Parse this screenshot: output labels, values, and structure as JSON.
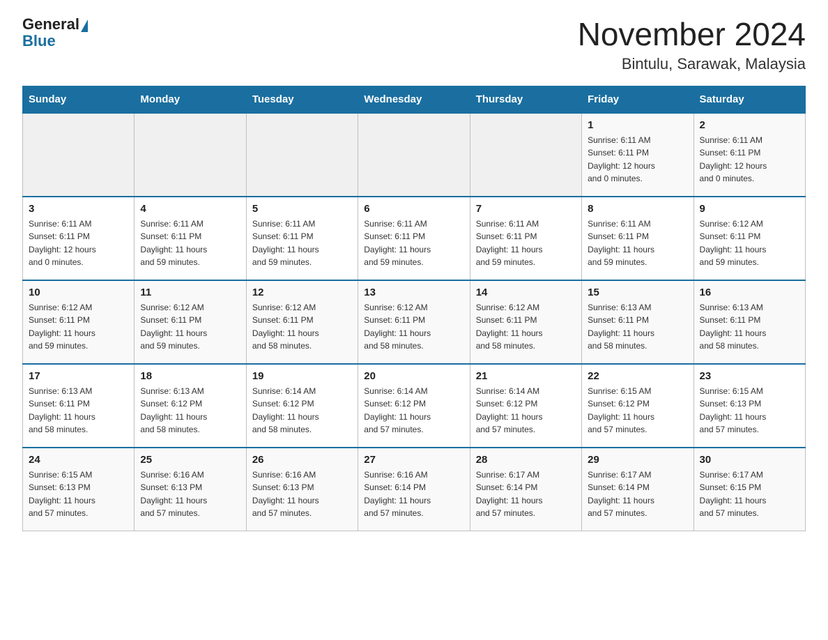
{
  "header": {
    "logo_general": "General",
    "logo_blue": "Blue",
    "month_title": "November 2024",
    "location": "Bintulu, Sarawak, Malaysia"
  },
  "days_of_week": [
    "Sunday",
    "Monday",
    "Tuesday",
    "Wednesday",
    "Thursday",
    "Friday",
    "Saturday"
  ],
  "weeks": [
    [
      {
        "day": "",
        "info": ""
      },
      {
        "day": "",
        "info": ""
      },
      {
        "day": "",
        "info": ""
      },
      {
        "day": "",
        "info": ""
      },
      {
        "day": "",
        "info": ""
      },
      {
        "day": "1",
        "info": "Sunrise: 6:11 AM\nSunset: 6:11 PM\nDaylight: 12 hours\nand 0 minutes."
      },
      {
        "day": "2",
        "info": "Sunrise: 6:11 AM\nSunset: 6:11 PM\nDaylight: 12 hours\nand 0 minutes."
      }
    ],
    [
      {
        "day": "3",
        "info": "Sunrise: 6:11 AM\nSunset: 6:11 PM\nDaylight: 12 hours\nand 0 minutes."
      },
      {
        "day": "4",
        "info": "Sunrise: 6:11 AM\nSunset: 6:11 PM\nDaylight: 11 hours\nand 59 minutes."
      },
      {
        "day": "5",
        "info": "Sunrise: 6:11 AM\nSunset: 6:11 PM\nDaylight: 11 hours\nand 59 minutes."
      },
      {
        "day": "6",
        "info": "Sunrise: 6:11 AM\nSunset: 6:11 PM\nDaylight: 11 hours\nand 59 minutes."
      },
      {
        "day": "7",
        "info": "Sunrise: 6:11 AM\nSunset: 6:11 PM\nDaylight: 11 hours\nand 59 minutes."
      },
      {
        "day": "8",
        "info": "Sunrise: 6:11 AM\nSunset: 6:11 PM\nDaylight: 11 hours\nand 59 minutes."
      },
      {
        "day": "9",
        "info": "Sunrise: 6:12 AM\nSunset: 6:11 PM\nDaylight: 11 hours\nand 59 minutes."
      }
    ],
    [
      {
        "day": "10",
        "info": "Sunrise: 6:12 AM\nSunset: 6:11 PM\nDaylight: 11 hours\nand 59 minutes."
      },
      {
        "day": "11",
        "info": "Sunrise: 6:12 AM\nSunset: 6:11 PM\nDaylight: 11 hours\nand 59 minutes."
      },
      {
        "day": "12",
        "info": "Sunrise: 6:12 AM\nSunset: 6:11 PM\nDaylight: 11 hours\nand 58 minutes."
      },
      {
        "day": "13",
        "info": "Sunrise: 6:12 AM\nSunset: 6:11 PM\nDaylight: 11 hours\nand 58 minutes."
      },
      {
        "day": "14",
        "info": "Sunrise: 6:12 AM\nSunset: 6:11 PM\nDaylight: 11 hours\nand 58 minutes."
      },
      {
        "day": "15",
        "info": "Sunrise: 6:13 AM\nSunset: 6:11 PM\nDaylight: 11 hours\nand 58 minutes."
      },
      {
        "day": "16",
        "info": "Sunrise: 6:13 AM\nSunset: 6:11 PM\nDaylight: 11 hours\nand 58 minutes."
      }
    ],
    [
      {
        "day": "17",
        "info": "Sunrise: 6:13 AM\nSunset: 6:11 PM\nDaylight: 11 hours\nand 58 minutes."
      },
      {
        "day": "18",
        "info": "Sunrise: 6:13 AM\nSunset: 6:12 PM\nDaylight: 11 hours\nand 58 minutes."
      },
      {
        "day": "19",
        "info": "Sunrise: 6:14 AM\nSunset: 6:12 PM\nDaylight: 11 hours\nand 58 minutes."
      },
      {
        "day": "20",
        "info": "Sunrise: 6:14 AM\nSunset: 6:12 PM\nDaylight: 11 hours\nand 57 minutes."
      },
      {
        "day": "21",
        "info": "Sunrise: 6:14 AM\nSunset: 6:12 PM\nDaylight: 11 hours\nand 57 minutes."
      },
      {
        "day": "22",
        "info": "Sunrise: 6:15 AM\nSunset: 6:12 PM\nDaylight: 11 hours\nand 57 minutes."
      },
      {
        "day": "23",
        "info": "Sunrise: 6:15 AM\nSunset: 6:13 PM\nDaylight: 11 hours\nand 57 minutes."
      }
    ],
    [
      {
        "day": "24",
        "info": "Sunrise: 6:15 AM\nSunset: 6:13 PM\nDaylight: 11 hours\nand 57 minutes."
      },
      {
        "day": "25",
        "info": "Sunrise: 6:16 AM\nSunset: 6:13 PM\nDaylight: 11 hours\nand 57 minutes."
      },
      {
        "day": "26",
        "info": "Sunrise: 6:16 AM\nSunset: 6:13 PM\nDaylight: 11 hours\nand 57 minutes."
      },
      {
        "day": "27",
        "info": "Sunrise: 6:16 AM\nSunset: 6:14 PM\nDaylight: 11 hours\nand 57 minutes."
      },
      {
        "day": "28",
        "info": "Sunrise: 6:17 AM\nSunset: 6:14 PM\nDaylight: 11 hours\nand 57 minutes."
      },
      {
        "day": "29",
        "info": "Sunrise: 6:17 AM\nSunset: 6:14 PM\nDaylight: 11 hours\nand 57 minutes."
      },
      {
        "day": "30",
        "info": "Sunrise: 6:17 AM\nSunset: 6:15 PM\nDaylight: 11 hours\nand 57 minutes."
      }
    ]
  ]
}
